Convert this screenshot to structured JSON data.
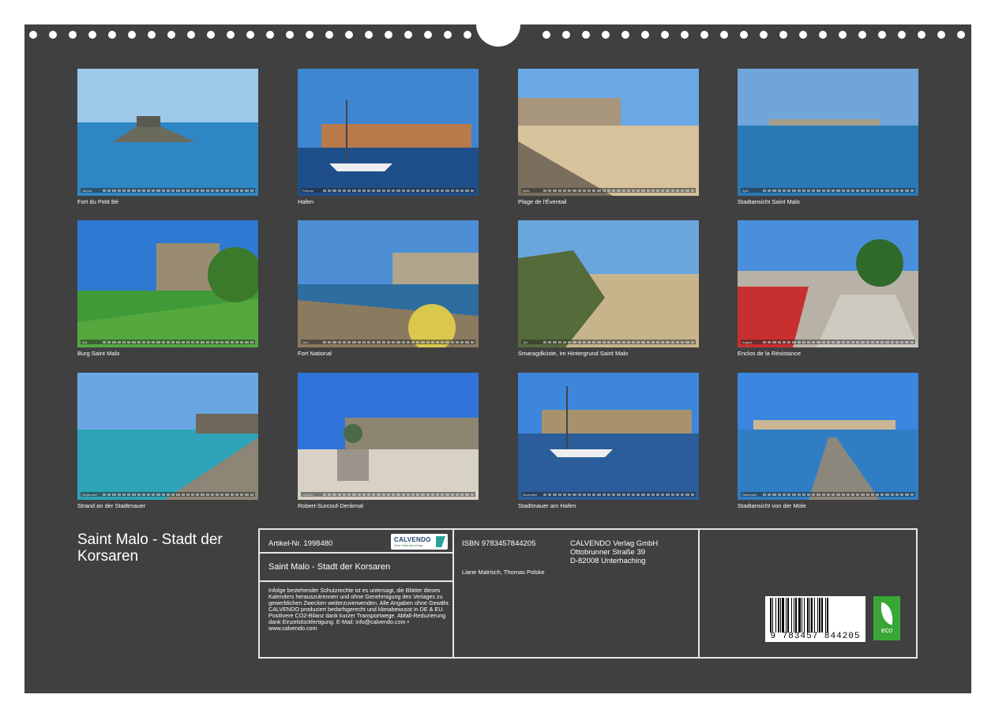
{
  "title": "Saint Malo - Stadt der Korsaren",
  "months": [
    {
      "short": "Januar",
      "caption": "Fort du Petit Bé"
    },
    {
      "short": "Februar",
      "caption": "Hafen"
    },
    {
      "short": "März",
      "caption": "Plage de l'Éventail"
    },
    {
      "short": "April",
      "caption": "Stadtansicht Saint Malo"
    },
    {
      "short": "Mai",
      "caption": "Burg Saint Malo"
    },
    {
      "short": "Juni",
      "caption": "Fort National"
    },
    {
      "short": "Juli",
      "caption": "Smaragdküste, im Hintergrund Saint Malo"
    },
    {
      "short": "August",
      "caption": "Enclos de la Résistance"
    },
    {
      "short": "September",
      "caption": "Strand an der Stadtmauer"
    },
    {
      "short": "Oktober",
      "caption": "Robert-Surcouf-Denkmal"
    },
    {
      "short": "November",
      "caption": "Stadtmauer am Hafen"
    },
    {
      "short": "Dezember",
      "caption": "Stadtansicht von der Mole"
    }
  ],
  "info": {
    "article": "Artikel-Nr. 1998480",
    "product_title": "Saint Malo - Stadt der Korsaren",
    "legal": "Infolge bestehender Schutzrechte ist es untersagt, die Blätter dieses Kalenders herauszutrennen und ohne Genehmigung des Verlages zu gewerblichen Zwecken weiterzuverwenden. Alle Angaben ohne Gewähr. CALVENDO produziert bedarfsgerecht und klimabewusst in DE & EU. Positivere CO2-Bilanz dank kurzer Transportwege. Abfall-Reduzierung dank Einzelstückfertigung. E-Mail: info@calvendo.com • www.calvendo.com",
    "isbn": "ISBN 9783457844205",
    "authors": "Liane Matrisch, Thomas Polske",
    "publisher": [
      "CALVENDO Verlag GmbH",
      "Ottobrunner Straße 39",
      "D-82008 Unterhaching"
    ],
    "logo_word": "CALVENDO",
    "logo_sub": "Dein Kalenderverlag",
    "barcode_number": "9 783457 844205",
    "eco_label": "eco"
  },
  "colors": {
    "background": "#404040",
    "text": "#ffffff",
    "eco_green": "#3aa635"
  }
}
